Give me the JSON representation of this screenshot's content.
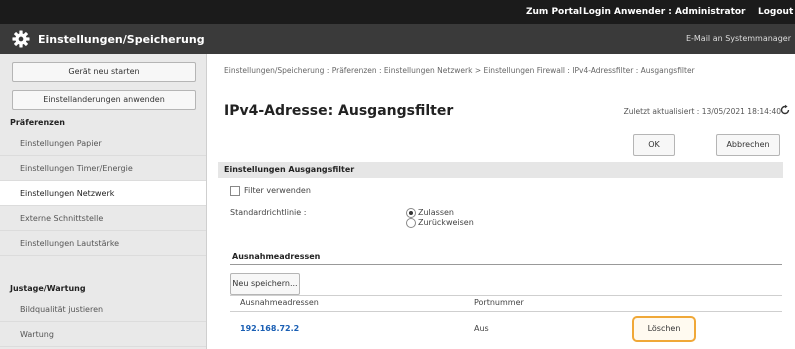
{
  "topbar": {
    "portal": "Zum Portal",
    "login": "Login Anwender : Administrator",
    "logout": "Logout"
  },
  "titlebar": {
    "title": "Einstellungen/Speicherung",
    "mail": "E-Mail an Systemmanager"
  },
  "sidebar": {
    "restart": "Gerät neu starten",
    "apply": "Einstellanderungen anwenden",
    "group1": "Präferenzen",
    "items1": [
      "Einstellungen Papier",
      "Einstellungen Timer/Energie",
      "Einstellungen Netzwerk",
      "Externe Schnittstelle",
      "Einstellungen Lautstärke"
    ],
    "group2": "Justage/Wartung",
    "items2": [
      "Bildqualität justieren",
      "Wartung"
    ]
  },
  "main": {
    "breadcrumb": "Einstellungen/Speicherung : Präferenzen : Einstellungen Netzwerk > Einstellungen Firewall : IPv4-Adressfilter : Ausgangsfilter",
    "title": "IPv4-Adresse: Ausgangsfilter",
    "updated": "Zuletzt aktualisiert : 13/05/2021 18:14:40",
    "ok": "OK",
    "cancel": "Abbrechen",
    "section1_title": "Einstellungen Ausgangsfilter",
    "use_filter": "Filter verwenden",
    "default_policy": "Standardrichtlinie :",
    "allow": "Zulassen",
    "reject": "Zurückweisen",
    "section2_title": "Ausnahmeadressen",
    "register_new": "Neu speichern...",
    "col_address": "Ausnahmeadressen",
    "col_port": "Portnummer",
    "row_address": "192.168.72.2",
    "row_port": "Aus",
    "delete": "Löschen"
  }
}
